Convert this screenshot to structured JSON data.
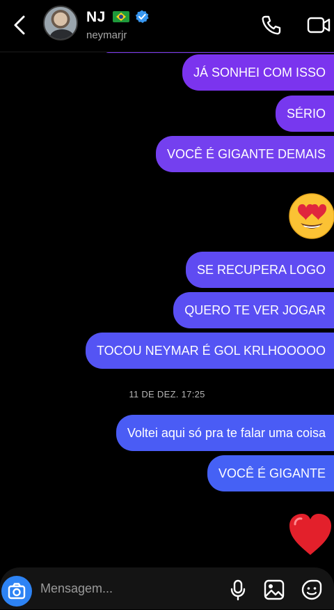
{
  "header": {
    "name": "NJ",
    "username": "neymarjr",
    "flag_icon": "brazil-flag-icon",
    "verified_icon": "verified-badge-icon"
  },
  "messages_block1": [
    {
      "text": "JÁ SONHEI COM ISSO",
      "color": "#7b34ee"
    },
    {
      "text": "SÉRIO",
      "color": "#7738ef"
    },
    {
      "text": "VOCÊ É GIGANTE DEMAIS",
      "color": "#7440ef"
    }
  ],
  "emoji_1": "😍",
  "messages_block2": [
    {
      "text": "SE RECUPERA LOGO",
      "color": "#5f4bf2"
    },
    {
      "text": "QUERO TE VER JOGAR",
      "color": "#5a4ff3"
    },
    {
      "text": "TOCOU NEYMAR É GOL KRLHOOOOO",
      "color": "#5454f4"
    }
  ],
  "timestamp": "11 DE DEZ. 17:25",
  "messages_block3": [
    {
      "text": "Voltei aqui só pra te falar uma coisa",
      "color": "#4a5cf5"
    },
    {
      "text": "VOCÊ É GIGANTE",
      "color": "#4561f5"
    }
  ],
  "emoji_2": "❤️",
  "composer": {
    "placeholder": "Mensagem...",
    "camera_color": "#2d83f4"
  },
  "icons": [
    "back-arrow-icon",
    "phone-icon",
    "video-camera-icon",
    "camera-icon",
    "microphone-icon",
    "gallery-icon",
    "sticker-icon"
  ]
}
